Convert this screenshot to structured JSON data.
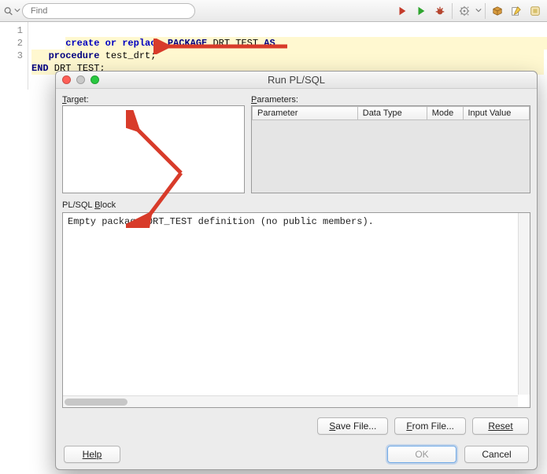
{
  "toolbar": {
    "find_placeholder": "Find"
  },
  "editor": {
    "lines": {
      "n1": "1",
      "n2": "2",
      "n3": "3",
      "l1a": "create or replace",
      "l1b": " PACKAGE ",
      "l1c": "DRT_TEST ",
      "l1d": "AS",
      "l2a": "   procedure",
      "l2b": " test_drt;",
      "l3a": "END",
      "l3b": " DRT_TEST;"
    }
  },
  "dialog": {
    "title": "Run PL/SQL",
    "target_label_pre": "T",
    "target_label_rest": "arget:",
    "params_label_pre": "P",
    "params_label_rest": "arameters:",
    "cols": {
      "param": "Parameter",
      "dtype": "Data Type",
      "mode": "Mode",
      "ival": "Input Value"
    },
    "block_label_pre": "PL/SQL ",
    "block_label_u": "B",
    "block_label_post": "lock",
    "block_text": "Empty package DRT_TEST definition (no public members).",
    "buttons": {
      "save": "Save File...",
      "from": "From File...",
      "reset": "Reset",
      "help": "Help",
      "ok": "OK",
      "cancel": "Cancel"
    }
  },
  "colors": {
    "arrow": "#d83b2a"
  }
}
